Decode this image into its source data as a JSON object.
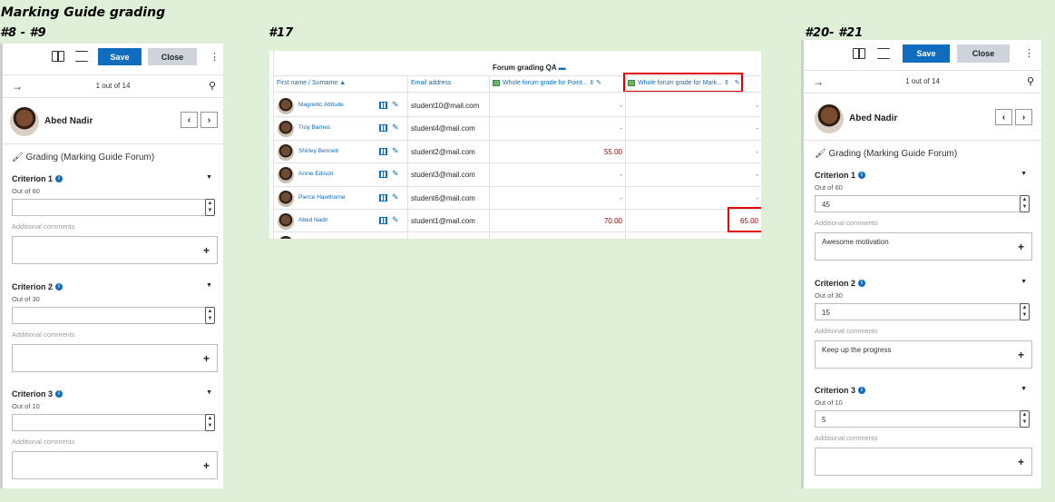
{
  "titles": {
    "main": "Marking Guide grading",
    "left": "#8 - #9",
    "middle": "#17",
    "right": "#20- #21"
  },
  "panel": {
    "save_label": "Save",
    "close_label": "Close",
    "kebab": "⋮",
    "nav_arrow": "→",
    "count": "1 out of 14",
    "user_name": "Abed Nadir",
    "prev": "‹",
    "next": "›",
    "grading_title": "Grading (Marking Guide Forum)",
    "criteria": [
      {
        "title": "Criterion 1",
        "outof": "Out of 60"
      },
      {
        "title": "Criterion 2",
        "outof": "Out of 30"
      },
      {
        "title": "Criterion 3",
        "outof": "Out of 10"
      }
    ],
    "additional": "Additional comments"
  },
  "right_values": {
    "crit1_score": "45",
    "crit1_comment": "Awesome motivation",
    "crit2_score": "15",
    "crit2_comment": "Keep up the progress",
    "crit3_score": "5",
    "crit3_comment": ""
  },
  "table": {
    "group_header": "Forum grading QA",
    "col_name": "First name / Surname",
    "col_email": "Email address",
    "col_point": "Whole forum grade for Point...",
    "col_mark": "Whole forum grade for Mark...",
    "rows": [
      {
        "name": "Magnetic Attitude",
        "email": "student10@mail.com",
        "point": "-",
        "mark": "-"
      },
      {
        "name": "Troy Barnes",
        "email": "student4@mail.com",
        "point": "-",
        "mark": "-"
      },
      {
        "name": "Shirley Bennett",
        "email": "student2@mail.com",
        "point": "55.00",
        "mark": "-"
      },
      {
        "name": "Annie Edison",
        "email": "student3@mail.com",
        "point": "-",
        "mark": "-"
      },
      {
        "name": "Pierce Hawthorne",
        "email": "student6@mail.com",
        "point": "-",
        "mark": "-"
      },
      {
        "name": "Abed Nadir",
        "email": "student1@mail.com",
        "point": "70.00",
        "mark": "65.00"
      }
    ]
  },
  "colors": {
    "accent": "#0f6cbf",
    "highlight": "#e00000",
    "background": "#e0efd8"
  }
}
